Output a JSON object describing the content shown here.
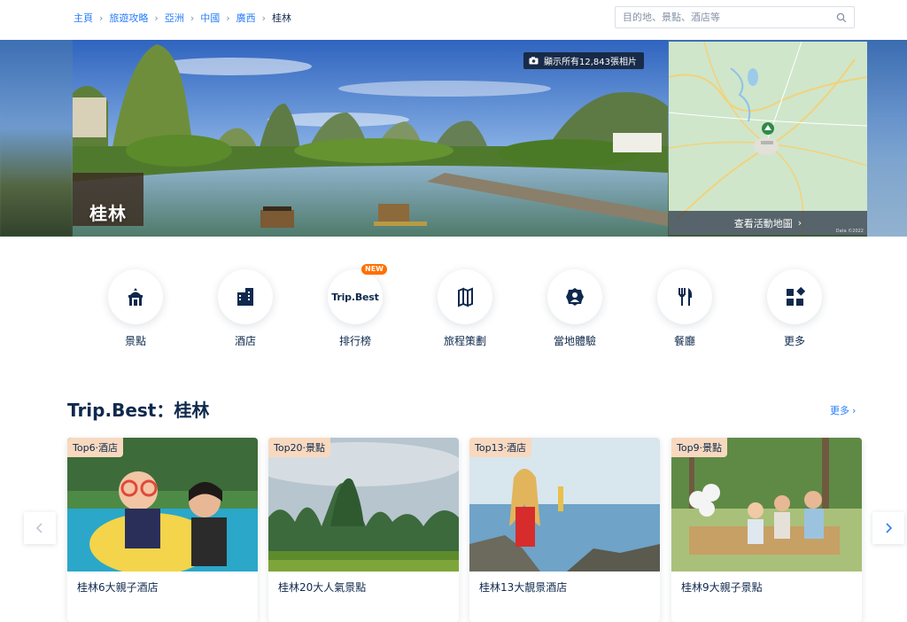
{
  "breadcrumb": {
    "items": [
      "主頁",
      "旅遊攻略",
      "亞洲",
      "中國",
      "廣西"
    ],
    "current": "桂林"
  },
  "search": {
    "placeholder": "目的地、景點、酒店等"
  },
  "hero": {
    "city": "桂林",
    "photo_count_label": "顯示所有12,843張相片",
    "map_label": "查看活動地圖",
    "map_credit": "Data ©2022"
  },
  "quick_links": [
    {
      "label": "景點",
      "icon": "attraction-icon"
    },
    {
      "label": "酒店",
      "icon": "hotel-icon"
    },
    {
      "label": "排行榜",
      "icon": "tripbest-icon",
      "logo_text": "Trip.Best",
      "badge": "NEW"
    },
    {
      "label": "旅程策劃",
      "icon": "itinerary-icon"
    },
    {
      "label": "當地體驗",
      "icon": "experience-icon"
    },
    {
      "label": "餐廳",
      "icon": "restaurant-icon"
    },
    {
      "label": "更多",
      "icon": "more-icon"
    }
  ],
  "section": {
    "title": "Trip.Best：桂林",
    "more": "更多"
  },
  "cards": [
    {
      "tag": "Top6·酒店",
      "title": "桂林6大親子酒店"
    },
    {
      "tag": "Top20·景點",
      "title": "桂林20大人氣景點"
    },
    {
      "tag": "Top13·酒店",
      "title": "桂林13大靚景酒店"
    },
    {
      "tag": "Top9·景點",
      "title": "桂林9大親子景點"
    }
  ],
  "colors": {
    "accent": "#287dfa",
    "text": "#0f294d",
    "badge": "#ff6f00",
    "tag_bg": "#f8d9bf"
  }
}
